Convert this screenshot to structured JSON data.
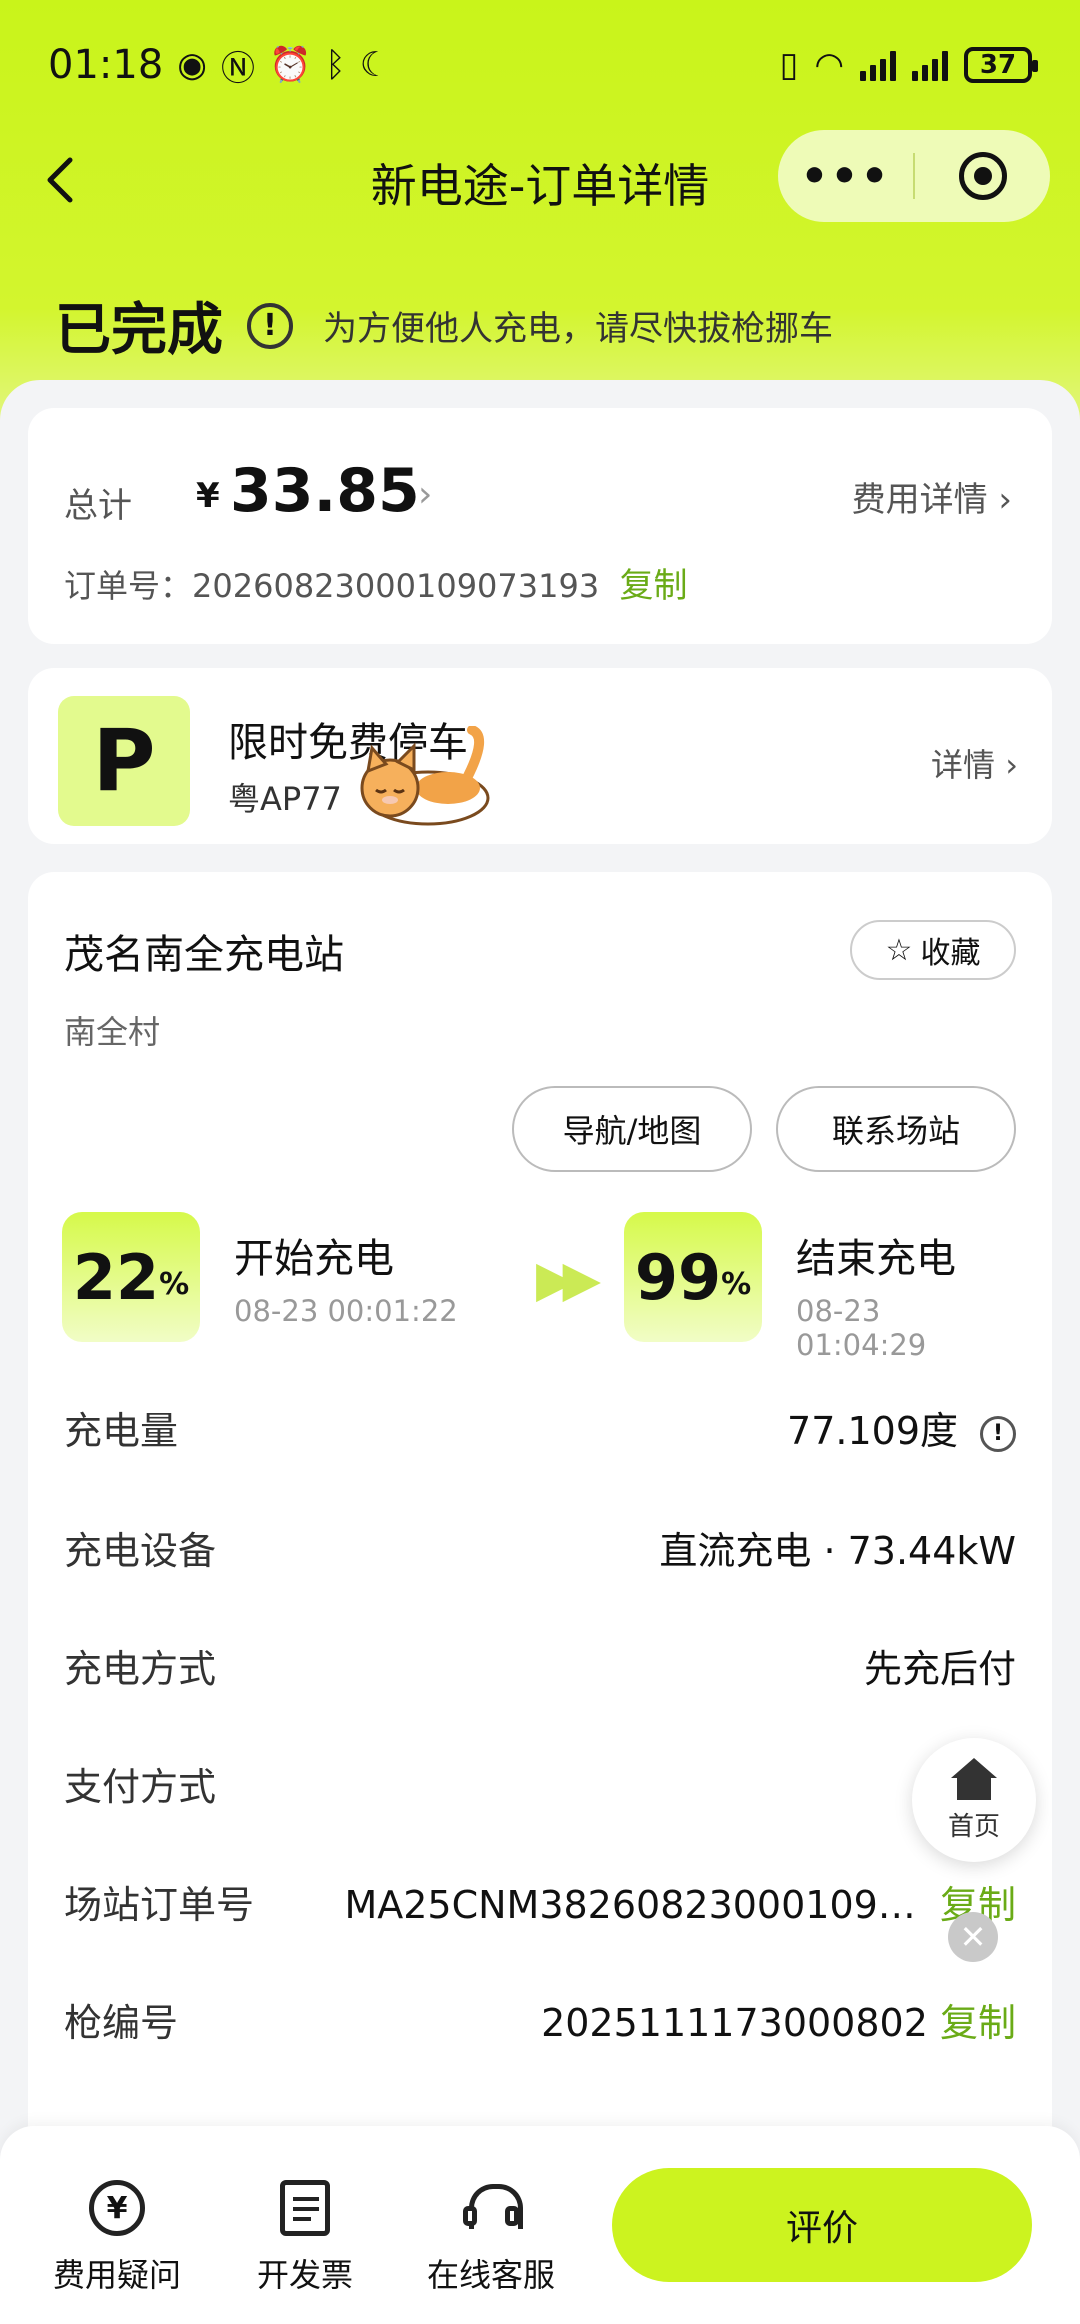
{
  "status_bar": {
    "time": "01:18",
    "battery": "37",
    "left_icons": [
      "eye-icon",
      "nfc-icon",
      "alarm-icon",
      "bluetooth-icon",
      "moon-icon"
    ],
    "right_icons": [
      "vibrate-icon",
      "wifi-icon",
      "signal-icon",
      "signal-icon"
    ]
  },
  "nav": {
    "title": "新电途-订单详情",
    "more_label": "•••"
  },
  "order_status": {
    "title": "已完成",
    "hint": "为方便他人充电，请尽快拔枪挪车"
  },
  "total": {
    "label": "总计",
    "currency": "¥",
    "amount": "33.85",
    "fee_detail_label": "费用详情",
    "order_no_label": "订单号：",
    "order_no": "20260823000109073193",
    "copy_label": "复制"
  },
  "parking": {
    "icon_letter": "P",
    "title": "限时免费停车",
    "plate": "粤AP77",
    "detail_label": "详情"
  },
  "station": {
    "name": "茂名南全充电站",
    "favorite_label": "收藏",
    "address": "南全村",
    "navigate_label": "导航/地图",
    "contact_label": "联系场站",
    "start": {
      "percent": "22",
      "percent_unit": "%",
      "title": "开始充电",
      "time": "08-23 00:01:22"
    },
    "end": {
      "percent": "99",
      "percent_unit": "%",
      "title": "结束充电",
      "time": "08-23 01:04:29"
    },
    "details": [
      {
        "key": "充电量",
        "value": "77.109度"
      },
      {
        "key": "充电设备",
        "value": "直流充电 · 73.44kW"
      },
      {
        "key": "充电方式",
        "value": "先充后付"
      },
      {
        "key": "支付方式",
        "value": ""
      },
      {
        "key": "场站订单号",
        "value": "MA25CNM38260823000109…",
        "action": "复制"
      },
      {
        "key": "枪编号",
        "value": "2025111173000802",
        "action": "复制"
      }
    ]
  },
  "floating": {
    "home_label": "首页",
    "close_label": "✕"
  },
  "bottom_bar": {
    "fee_question_label": "费用疑问",
    "yuan_symbol": "¥",
    "invoice_label": "开发票",
    "service_label": "在线客服",
    "rate_label": "评价"
  },
  "colors": {
    "brand_lime": "#ccf31f",
    "copy_green": "#6aab17"
  }
}
